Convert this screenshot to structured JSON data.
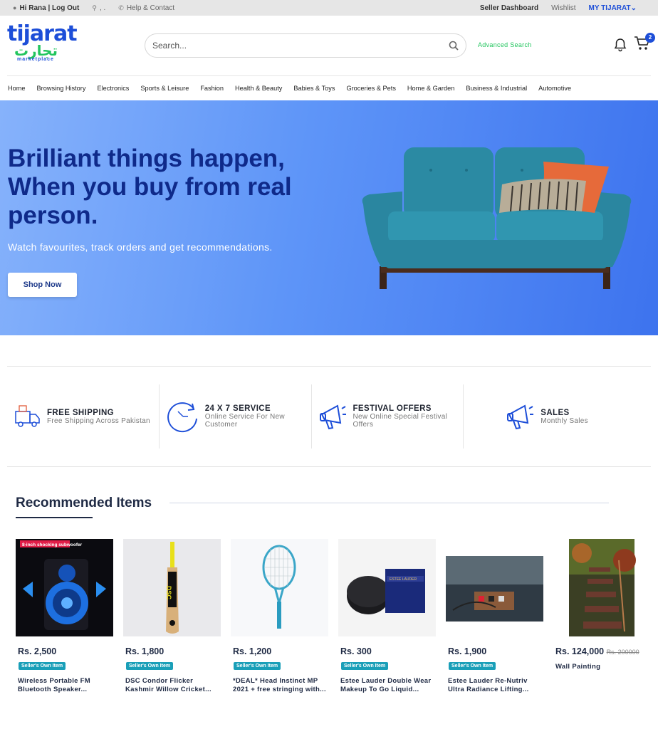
{
  "topbar": {
    "greeting": "Hi Rana | Log Out",
    "location": ", .",
    "help": "Help & Contact",
    "seller_dashboard": "Seller Dashboard",
    "wishlist": "Wishlist",
    "my_tijarat": "MY TIJARAT"
  },
  "header": {
    "logo_latin": "tijarat",
    "logo_urdu": "تجارت",
    "logo_sub": "marketplace",
    "search_placeholder": "Search...",
    "advanced_search": "Advanced Search",
    "cart_count": "2"
  },
  "nav": [
    "Home",
    "Browsing History",
    "Electronics",
    "Sports & Leisure",
    "Fashion",
    "Health & Beauty",
    "Babies & Toys",
    "Groceries & Pets",
    "Home & Garden",
    "Business & Industrial",
    "Automotive"
  ],
  "hero": {
    "line1": "Brilliant things happen,",
    "line2": "When you buy from real",
    "line3": "person.",
    "subtitle": "Watch favourites, track orders and get recommendations.",
    "cta": "Shop Now"
  },
  "features": [
    {
      "title": "FREE SHIPPING",
      "subtitle": "Free Shipping Across Pakistan",
      "icon": "truck-icon"
    },
    {
      "title": "24 X 7 SERVICE",
      "subtitle": "Online Service For New Customer",
      "icon": "clock-icon"
    },
    {
      "title": "FESTIVAL OFFERS",
      "subtitle": "New Online Special Festival Offers",
      "icon": "megaphone-icon"
    },
    {
      "title": "SALES",
      "subtitle": "Monthly Sales",
      "icon": "megaphone-icon"
    }
  ],
  "recommended": {
    "title": "Recommended Items",
    "items": [
      {
        "price": "Rs. 2,500",
        "old_price": "",
        "tag": "Seller's Own Item",
        "name": "Wireless Portable FM Bluetooth Speaker...",
        "image_text": "8-inch shocking subwoofer"
      },
      {
        "price": "Rs. 1,800",
        "old_price": "",
        "tag": "Seller's Own Item",
        "name": "DSC Condor Flicker Kashmir Willow Cricket...",
        "image_text": "DSC"
      },
      {
        "price": "Rs. 1,200",
        "old_price": "",
        "tag": "Seller's Own Item",
        "name": "*DEAL* Head Instinct MP 2021 + free stringing with...",
        "image_text": ""
      },
      {
        "price": "Rs. 300",
        "old_price": "",
        "tag": "Seller's Own Item",
        "name": "Estee Lauder Double Wear Makeup To Go Liquid...",
        "image_text": "ESTEE LAUDER"
      },
      {
        "price": "Rs. 1,900",
        "old_price": "",
        "tag": "Seller's Own Item",
        "name": "Estee Lauder Re-Nutriv Ultra Radiance Lifting...",
        "image_text": ""
      },
      {
        "price": "Rs. 124,000",
        "old_price": "Rs. 200000",
        "tag": "",
        "name": "Wall Painting",
        "image_text": ""
      }
    ]
  },
  "colors": {
    "brand_blue": "#1d4ed8",
    "brand_green": "#22c55e",
    "tag_teal": "#1a9fb8",
    "hero_text": "#0f2a8a"
  }
}
